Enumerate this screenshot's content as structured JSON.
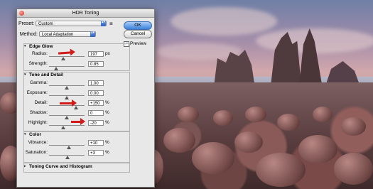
{
  "window": {
    "title": "HDR Toning"
  },
  "preset": {
    "label": "Preset:",
    "value": "Custom"
  },
  "method": {
    "label": "Method:",
    "value": "Local Adaptation"
  },
  "buttons": {
    "ok": "OK",
    "cancel": "Cancel"
  },
  "preview": {
    "label": "Preview",
    "checked": true,
    "check_glyph": "✓"
  },
  "edge_glow": {
    "title": "Edge Glow",
    "radius": {
      "label": "Radius:",
      "value": "197",
      "unit": "px",
      "level": 0.39
    },
    "strength": {
      "label": "Strength:",
      "value": "0.85",
      "unit": "",
      "level": 0.2
    }
  },
  "tone_detail": {
    "title": "Tone and Detail",
    "gamma": {
      "label": "Gamma:",
      "value": "1.00",
      "level": 0.5
    },
    "exposure": {
      "label": "Exposure:",
      "value": "0.00",
      "level": 0.5
    },
    "detail": {
      "label": "Detail:",
      "value": "+150",
      "unit": "%",
      "level": 0.75
    },
    "shadow": {
      "label": "Shadow:",
      "value": "0",
      "unit": "%",
      "level": 0.5
    },
    "highlight": {
      "label": "Highlight:",
      "value": "-20",
      "unit": "%",
      "level": 0.4
    }
  },
  "color": {
    "title": "Color",
    "vibrance": {
      "label": "Vibrance:",
      "value": "+10",
      "unit": "%",
      "level": 0.55
    },
    "saturation": {
      "label": "Saturation:",
      "value": "+3",
      "unit": "%",
      "level": 0.51
    }
  },
  "toning_curve": {
    "title": "Toning Curve and Histogram"
  },
  "icons": {
    "collapse": "▾",
    "expand": "▸",
    "menu": "≡",
    "select_arrows": "▴▾"
  },
  "colors": {
    "annotation_arrow": "#d11a1a",
    "default_button": "#3b82db"
  }
}
